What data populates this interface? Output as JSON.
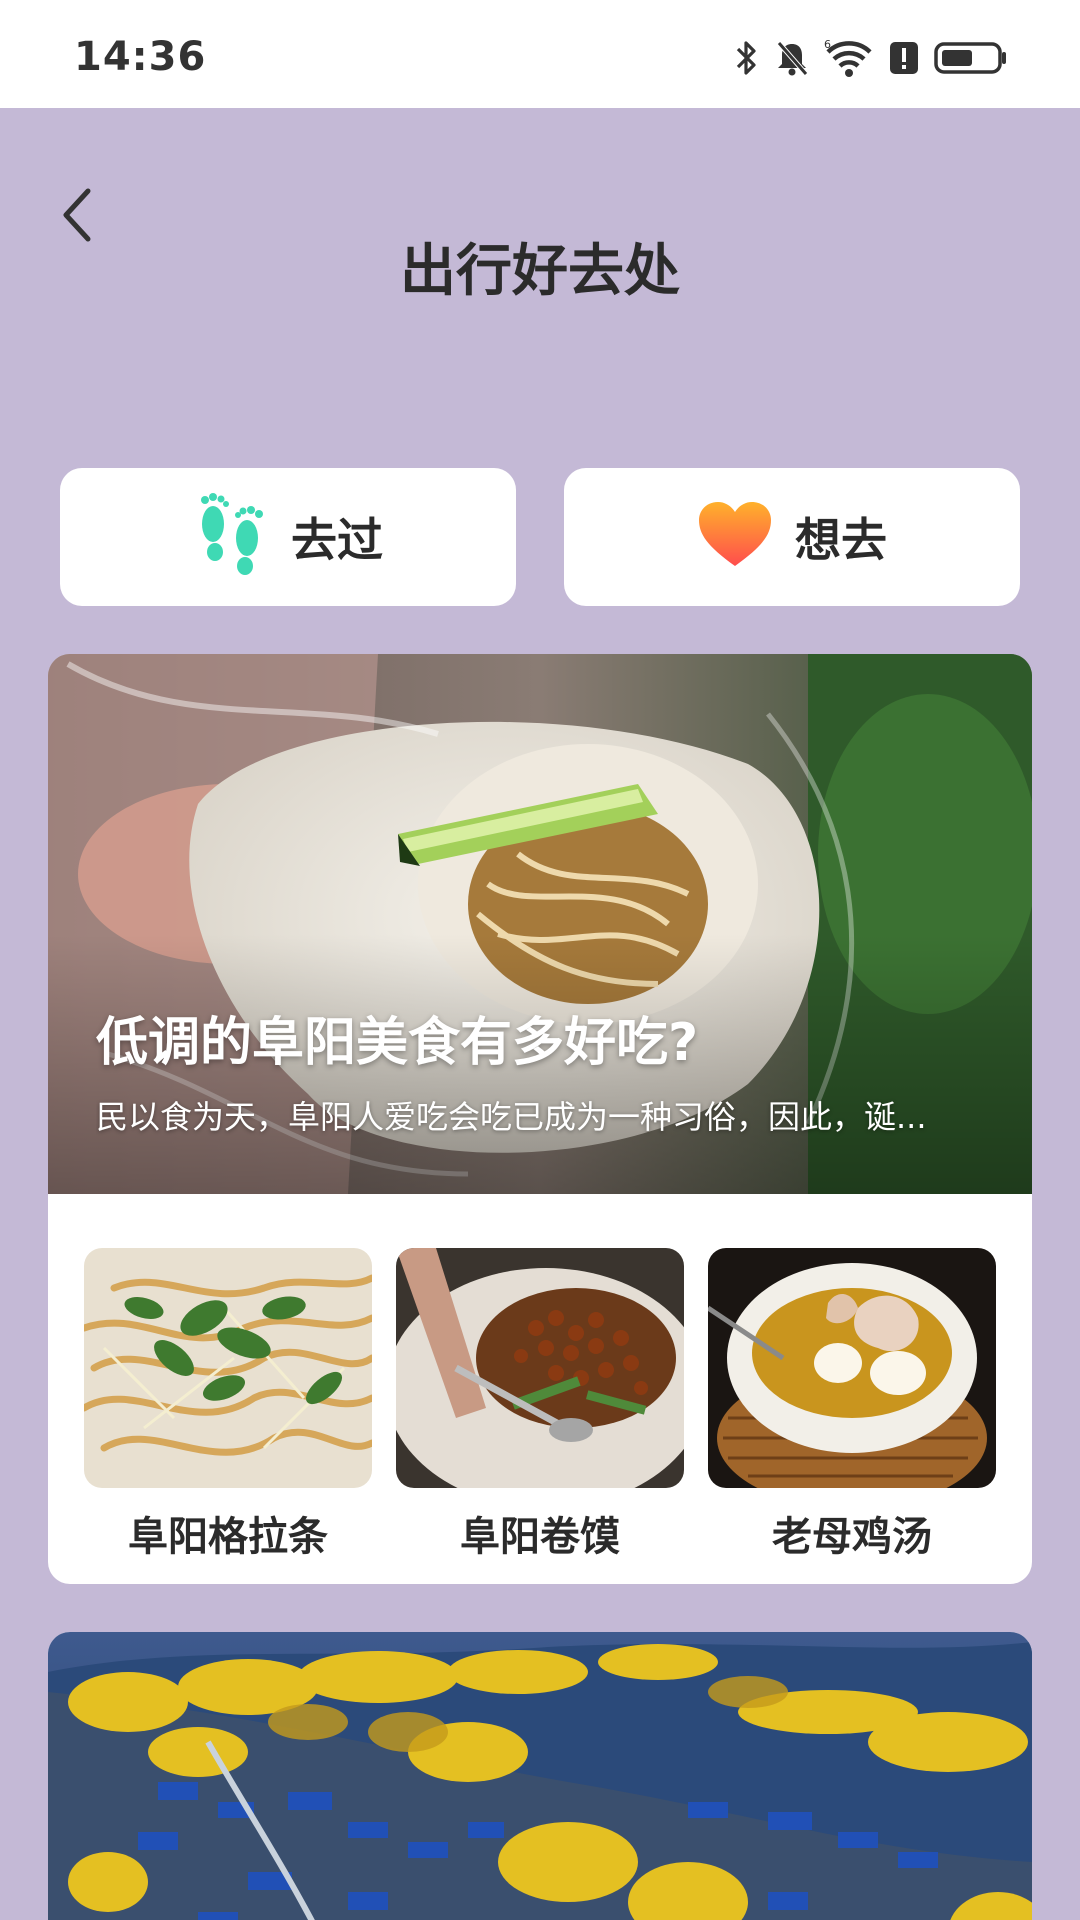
{
  "status_bar": {
    "time": "14:36",
    "icons": [
      "bluetooth-icon",
      "mute-icon",
      "wifi-icon",
      "alert-icon",
      "battery-icon"
    ]
  },
  "header": {
    "back_icon": "chevron-left-icon",
    "title": "出行好去处"
  },
  "actions": [
    {
      "icon": "footprints-icon",
      "label": "去过",
      "icon_color": "#3fd9b4"
    },
    {
      "icon": "heart-icon",
      "label": "想去",
      "icon_color": "#ff6a3d"
    }
  ],
  "featured_food": {
    "title": "低调的阜阳美食有多好吃?",
    "summary": "民以食为天，阜阳人爱吃会吃已成为一种习俗，因此，诞...",
    "items": [
      {
        "label": "阜阳格拉条"
      },
      {
        "label": "阜阳卷馍"
      },
      {
        "label": "老母鸡汤"
      }
    ]
  },
  "colors": {
    "background": "#c4b9d6",
    "card": "#ffffff",
    "text": "#2b2b2b"
  }
}
